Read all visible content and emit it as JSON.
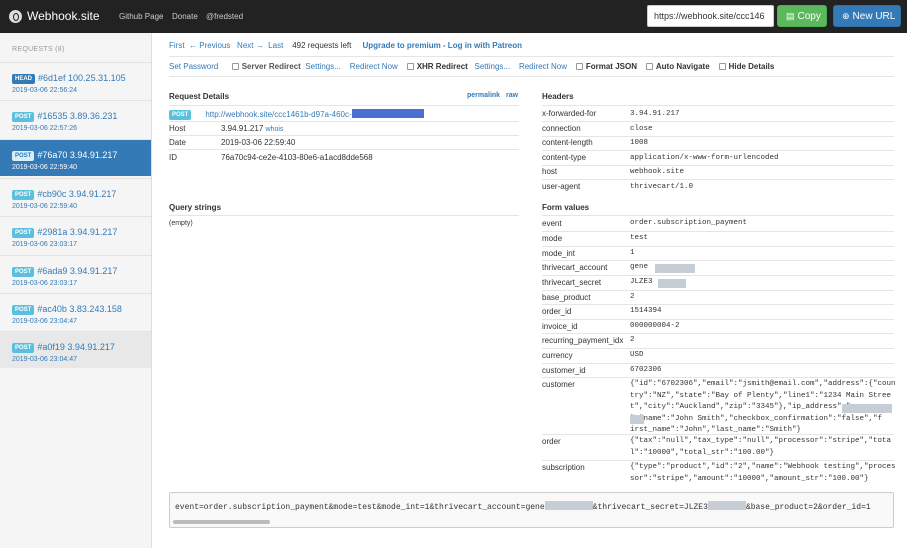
{
  "app": {
    "title": "Webhook.site",
    "nav": [
      "Github Page",
      "Donate",
      "@fredsted"
    ],
    "url": "https://webhook.site/ccc146",
    "copy_label": "Copy",
    "new_url_label": "New URL",
    "accent": "#337ab7"
  },
  "sidebar": {
    "header": "REQUESTS (8)",
    "items": [
      {
        "method": "HEAD",
        "title": "#6d1ef 100.25.31.105",
        "time": "2019-03-06 22:56:24"
      },
      {
        "method": "POST",
        "title": "#16535 3.89.36.231",
        "time": "2019-03-06 22:57:26"
      },
      {
        "method": "POST",
        "title": "#76a70 3.94.91.217",
        "time": "2019-03-06 22:59:40"
      },
      {
        "method": "POST",
        "title": "#cb90c 3.94.91.217",
        "time": "2019-03-06 22:59:40"
      },
      {
        "method": "POST",
        "title": "#2981a 3.94.91.217",
        "time": "2019-03-06 23:03:17"
      },
      {
        "method": "POST",
        "title": "#6ada9 3.94.91.217",
        "time": "2019-03-06 23:03:17"
      },
      {
        "method": "POST",
        "title": "#ac40b 3.83.243.158",
        "time": "2019-03-06 23:04:47"
      },
      {
        "method": "POST",
        "title": "#a0f19 3.94.91.217",
        "time": "2019-03-06 23:04:47"
      }
    ]
  },
  "pager": {
    "first": "First",
    "previous": "← Previous",
    "next": "Next →",
    "last": "Last",
    "count": "492 requests left",
    "upgrade": "Upgrade to premium - Log in with Patreon"
  },
  "options": {
    "set_password": "Set Password",
    "server_redirect": "Server Redirect",
    "settings1": "Settings...",
    "redirect_now1": "Redirect Now",
    "xhr_redirect": "XHR Redirect",
    "settings2": "Settings...",
    "redirect_now2": "Redirect Now",
    "format_json": "Format JSON",
    "auto_navigate": "Auto Navigate",
    "hide_details": "Hide Details"
  },
  "details": {
    "title": "Request Details",
    "permalink": "permalink",
    "raw": "raw",
    "method": "POST",
    "url": "http://webhook.site/ccc1461b-d97a-460c-",
    "host_label": "Host",
    "host": "3.94.91.217",
    "whois": "whois",
    "date_label": "Date",
    "date": "2019-03-06 22:59:40",
    "id_label": "ID",
    "id": "76a70c94-ce2e-4103-80e6-a1acd8dde568"
  },
  "query": {
    "title": "Query strings",
    "empty": "(empty)"
  },
  "headers": {
    "title": "Headers",
    "rows": [
      {
        "k": "x-forwarded-for",
        "v": "3.94.91.217"
      },
      {
        "k": "connection",
        "v": "close"
      },
      {
        "k": "content-length",
        "v": "1008"
      },
      {
        "k": "content-type",
        "v": "application/x-www-form-urlencoded"
      },
      {
        "k": "host",
        "v": "webhook.site"
      },
      {
        "k": "user-agent",
        "v": "thrivecart/1.0"
      }
    ]
  },
  "form": {
    "title": "Form values",
    "rows": [
      {
        "k": "event",
        "v": "order.subscription_payment"
      },
      {
        "k": "mode",
        "v": "test"
      },
      {
        "k": "mode_int",
        "v": "1"
      },
      {
        "k": "thrivecart_account",
        "v": "gene"
      },
      {
        "k": "thrivecart_secret",
        "v": "JLZE3"
      },
      {
        "k": "base_product",
        "v": "2"
      },
      {
        "k": "order_id",
        "v": "1514394"
      },
      {
        "k": "invoice_id",
        "v": "000000004-2"
      },
      {
        "k": "recurring_payment_idx",
        "v": "2"
      },
      {
        "k": "currency",
        "v": "USD"
      },
      {
        "k": "customer_id",
        "v": "6702306"
      },
      {
        "k": "customer",
        "v": "{\"id\":\"6702306\",\"email\":\"jsmith@email.com\",\"address\":{\"coun\ntry\":\"NZ\",\"state\":\"Bay of Plenty\",\"line1\":\"1234 Main Stree\nt\",\"city\":\"Auckland\",\"zip\":\"3345\"},\"ip_address\":\"\n\",\"name\":\"John Smith\",\"checkbox_confirmation\":\"false\",\"f\nirst_name\":\"John\",\"last_name\":\"Smith\"}"
      },
      {
        "k": "order",
        "v": "{\"tax\":\"null\",\"tax_type\":\"null\",\"processor\":\"stripe\",\"tota\nl\":\"10000\",\"total_str\":\"100.00\"}"
      },
      {
        "k": "subscription",
        "v": "{\"type\":\"product\",\"id\":\"2\",\"name\":\"Webhook testing\",\"proces\nsor\":\"stripe\",\"amount\":\"10000\",\"amount_str\":\"100.00\"}"
      }
    ]
  },
  "raw_body": {
    "p1": "event=order.subscription_payment&mode=test&mode_int=1&thrivecart_account=gene",
    "p2": "&thrivecart_secret=JLZE3",
    "p3": "&base_product=2&order_id=1"
  }
}
